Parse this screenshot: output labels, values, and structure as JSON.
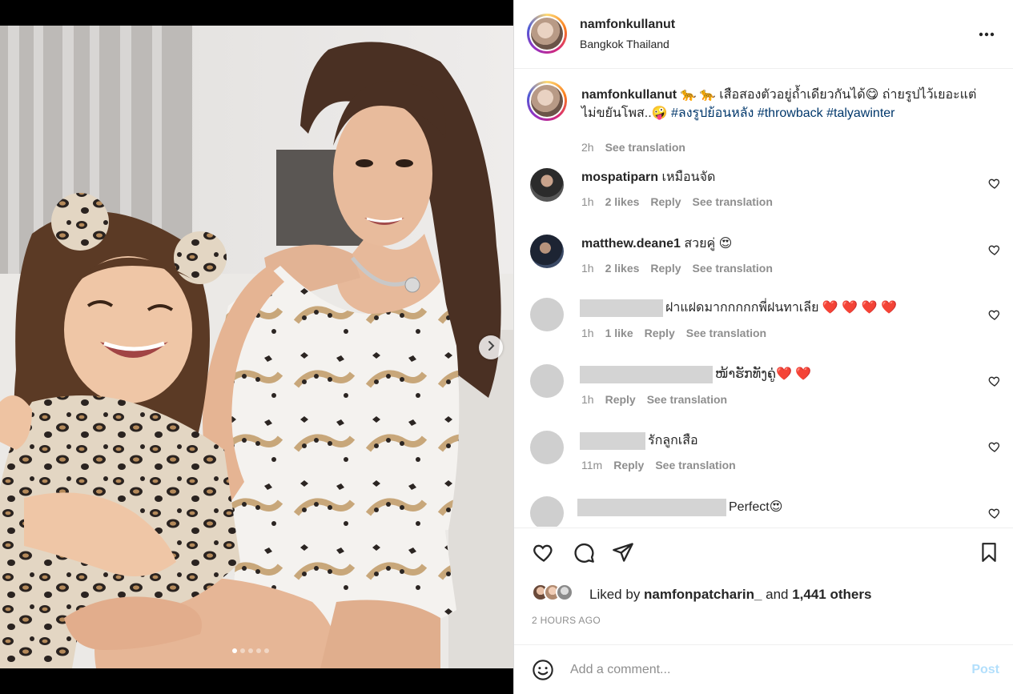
{
  "post": {
    "username": "namfonkullanut",
    "location": "Bangkok Thailand",
    "more_icon": "more-horizontal-icon"
  },
  "caption": {
    "username": "namfonkullanut",
    "text_1": "🐆 🐆 เสือสองตัวอยู่ถ้ำเดียวกันได้😋 ถ่ายรูปไว้เยอะแต่ไม่ขยันโพส..🤪 ",
    "hashtags": [
      "#ลงรูปย้อนหลัง",
      "#throwback",
      "#talyawinter"
    ],
    "time": "2h",
    "see_translation": "See translation"
  },
  "comments": [
    {
      "username": "mospatiparn",
      "text": "เหมือนจัด",
      "time": "1h",
      "likes": "2 likes",
      "reply": "Reply",
      "see_translation": "See translation"
    },
    {
      "username": "matthew.deane1",
      "text": "สวยคู่ 😍",
      "time": "1h",
      "likes": "2 likes",
      "reply": "Reply",
      "see_translation": "See translation"
    },
    {
      "username": "",
      "text": "ฝาแฝดมากกกกกพี่ฝนทาเลีย ❤️ ❤️ ❤️ ❤️",
      "time": "1h",
      "likes": "1 like",
      "reply": "Reply",
      "see_translation": "See translation"
    },
    {
      "username": "",
      "text": "ໜ້າຮັກທັງຄູ່❤️ ❤️",
      "time": "1h",
      "reply": "Reply",
      "see_translation": "See translation"
    },
    {
      "username": "",
      "text": "รักลูกเสือ",
      "time": "11m",
      "reply": "Reply",
      "see_translation": "See translation"
    },
    {
      "username": "",
      "text": "Perfect😍"
    }
  ],
  "footer": {
    "liked_prefix": "Liked by ",
    "liked_user": "namfonpatcharin_",
    "liked_and": " and ",
    "liked_count": "1,441 others",
    "time_ago": "2 HOURS AGO",
    "comment_placeholder": "Add a comment...",
    "post_label": "Post"
  },
  "carousel": {
    "slide_count": 5,
    "active_index": 0
  },
  "colors": {
    "link": "#00376b",
    "secondary_text": "#8e8e8e",
    "post_disabled": "#b2dffc"
  }
}
